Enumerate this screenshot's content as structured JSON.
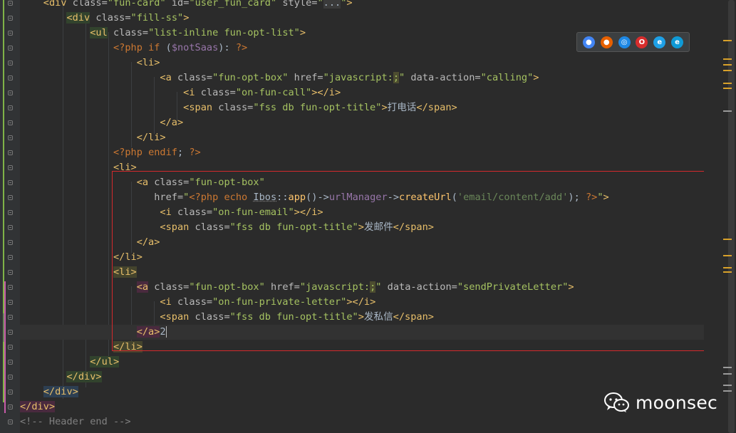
{
  "editor": {
    "lines": [
      [
        {
          "t": "    "
        },
        {
          "t": "<",
          "c": "tag"
        },
        {
          "t": "div ",
          "c": "tag"
        },
        {
          "t": "class=",
          "c": "attr"
        },
        {
          "t": "\"fun-card\"",
          "c": "val"
        },
        {
          "t": " id=",
          "c": "attr"
        },
        {
          "t": "\"user_fun_card\"",
          "c": "val"
        },
        {
          "t": " style=",
          "c": "attr"
        },
        {
          "t": "\"",
          "c": "val"
        },
        {
          "t": "...",
          "c": "fold"
        },
        {
          "t": "\"",
          "c": "val"
        },
        {
          "t": ">",
          "c": "tag"
        }
      ],
      [
        {
          "t": "        "
        },
        {
          "t": "<div",
          "c": "tag",
          "h": "green"
        },
        {
          "t": " class=",
          "c": "attr"
        },
        {
          "t": "\"fill-ss\"",
          "c": "val"
        },
        {
          "t": ">",
          "c": "tag"
        }
      ],
      [
        {
          "t": "            "
        },
        {
          "t": "<ul",
          "c": "tag",
          "h": "green"
        },
        {
          "t": " class=",
          "c": "attr"
        },
        {
          "t": "\"list-inline fun-opt-list\"",
          "c": "val"
        },
        {
          "t": ">",
          "c": "tag"
        }
      ],
      [
        {
          "t": "                "
        },
        {
          "t": "<?php ",
          "c": "php"
        },
        {
          "t": "if ",
          "c": "php"
        },
        {
          "t": "(",
          "c": "pl"
        },
        {
          "t": "$notSaas",
          "c": "var"
        },
        {
          "t": "): ",
          "c": "pl"
        },
        {
          "t": "?>",
          "c": "php"
        }
      ],
      [
        {
          "t": "                    "
        },
        {
          "t": "<li>",
          "c": "tag"
        }
      ],
      [
        {
          "t": "                        "
        },
        {
          "t": "<a",
          "c": "tag"
        },
        {
          "t": " class=",
          "c": "attr"
        },
        {
          "t": "\"fun-opt-box\"",
          "c": "val"
        },
        {
          "t": " href=",
          "c": "attr"
        },
        {
          "t": "\"javascript:",
          "c": "val"
        },
        {
          "t": ";",
          "c": "val",
          "h": "semi"
        },
        {
          "t": "\"",
          "c": "val"
        },
        {
          "t": " data-action=",
          "c": "attr"
        },
        {
          "t": "\"calling\"",
          "c": "val"
        },
        {
          "t": ">",
          "c": "tag"
        }
      ],
      [
        {
          "t": "                            "
        },
        {
          "t": "<i",
          "c": "tag"
        },
        {
          "t": " class=",
          "c": "attr"
        },
        {
          "t": "\"on-fun-call\"",
          "c": "val"
        },
        {
          "t": "></i>",
          "c": "tag"
        }
      ],
      [
        {
          "t": "                            "
        },
        {
          "t": "<span",
          "c": "tag"
        },
        {
          "t": " class=",
          "c": "attr"
        },
        {
          "t": "\"fss db fun-opt-title\"",
          "c": "val"
        },
        {
          "t": ">",
          "c": "tag"
        },
        {
          "t": "打电话",
          "c": "pl"
        },
        {
          "t": "</span>",
          "c": "tag"
        }
      ],
      [
        {
          "t": "                        "
        },
        {
          "t": "</a>",
          "c": "tag"
        }
      ],
      [
        {
          "t": "                    "
        },
        {
          "t": "</li>",
          "c": "tag"
        }
      ],
      [
        {
          "t": "                "
        },
        {
          "t": "<?php ",
          "c": "php"
        },
        {
          "t": "endif",
          "c": "php"
        },
        {
          "t": "; ",
          "c": "pl"
        },
        {
          "t": "?>",
          "c": "php"
        }
      ],
      [
        {
          "t": "                "
        },
        {
          "t": "<li>",
          "c": "tag"
        }
      ],
      [
        {
          "t": "                    "
        },
        {
          "t": "<a",
          "c": "tag"
        },
        {
          "t": " class=",
          "c": "attr"
        },
        {
          "t": "\"fun-opt-box\"",
          "c": "val"
        }
      ],
      [
        {
          "t": "                       "
        },
        {
          "t": "href=",
          "c": "attr"
        },
        {
          "t": "\"",
          "c": "val"
        },
        {
          "t": "<?php ",
          "c": "php"
        },
        {
          "t": "echo ",
          "c": "php"
        },
        {
          "t": "Ibos",
          "c": "cls"
        },
        {
          "t": "::",
          "c": "pl"
        },
        {
          "t": "app",
          "c": "fn"
        },
        {
          "t": "()->",
          "c": "pl"
        },
        {
          "t": "urlManager",
          "c": "var"
        },
        {
          "t": "->",
          "c": "pl"
        },
        {
          "t": "createUrl",
          "c": "fn"
        },
        {
          "t": "(",
          "c": "pl"
        },
        {
          "t": "'email/content/add'",
          "c": "sq"
        },
        {
          "t": "); ",
          "c": "pl"
        },
        {
          "t": "?>",
          "c": "php"
        },
        {
          "t": "\"",
          "c": "val"
        },
        {
          "t": ">",
          "c": "tag"
        }
      ],
      [
        {
          "t": "                        "
        },
        {
          "t": "<i",
          "c": "tag"
        },
        {
          "t": " class=",
          "c": "attr"
        },
        {
          "t": "\"on-fun-email\"",
          "c": "val"
        },
        {
          "t": "></i>",
          "c": "tag"
        }
      ],
      [
        {
          "t": "                        "
        },
        {
          "t": "<span",
          "c": "tag"
        },
        {
          "t": " class=",
          "c": "attr"
        },
        {
          "t": "\"fss db fun-opt-title\"",
          "c": "val"
        },
        {
          "t": ">",
          "c": "tag"
        },
        {
          "t": "发邮件",
          "c": "pl"
        },
        {
          "t": "</span>",
          "c": "tag"
        }
      ],
      [
        {
          "t": "                    "
        },
        {
          "t": "</a>",
          "c": "tag"
        }
      ],
      [
        {
          "t": "                "
        },
        {
          "t": "</li>",
          "c": "tag"
        }
      ],
      [
        {
          "t": "                "
        },
        {
          "t": "<li>",
          "c": "tag",
          "h": "yellow"
        }
      ],
      [
        {
          "t": "                    "
        },
        {
          "t": "<a",
          "c": "tag",
          "h": "pink"
        },
        {
          "t": " class=",
          "c": "attr"
        },
        {
          "t": "\"fun-opt-box\"",
          "c": "val"
        },
        {
          "t": " href=",
          "c": "attr"
        },
        {
          "t": "\"javascript:",
          "c": "val"
        },
        {
          "t": ";",
          "c": "val",
          "h": "semi"
        },
        {
          "t": "\"",
          "c": "val"
        },
        {
          "t": " data-action=",
          "c": "attr"
        },
        {
          "t": "\"sendPrivateLetter\"",
          "c": "val"
        },
        {
          "t": ">",
          "c": "tag"
        }
      ],
      [
        {
          "t": "                        "
        },
        {
          "t": "<i",
          "c": "tag"
        },
        {
          "t": " class=",
          "c": "attr"
        },
        {
          "t": "\"on-fun-private-letter\"",
          "c": "val"
        },
        {
          "t": "></i>",
          "c": "tag"
        }
      ],
      [
        {
          "t": "                        "
        },
        {
          "t": "<span",
          "c": "tag"
        },
        {
          "t": " class=",
          "c": "attr"
        },
        {
          "t": "\"fss db fun-opt-title\"",
          "c": "val"
        },
        {
          "t": ">",
          "c": "tag"
        },
        {
          "t": "发私信",
          "c": "pl"
        },
        {
          "t": "</span>",
          "c": "tag"
        }
      ],
      [
        {
          "t": "                    "
        },
        {
          "t": "</a>",
          "c": "tag",
          "h": "pink"
        },
        {
          "t": "2",
          "c": "pl",
          "caret": true
        }
      ],
      [
        {
          "t": "                "
        },
        {
          "t": "</li>",
          "c": "tag",
          "h": "yellow"
        }
      ],
      [
        {
          "t": "            "
        },
        {
          "t": "</ul>",
          "c": "tag",
          "h": "green"
        }
      ],
      [
        {
          "t": "        "
        },
        {
          "t": "</div>",
          "c": "tag",
          "h": "green"
        }
      ],
      [
        {
          "t": "    "
        },
        {
          "t": "</div>",
          "c": "tag",
          "h": "blue"
        }
      ],
      [
        {
          "t": "</div>",
          "c": "tag",
          "h": "pink"
        }
      ],
      [
        {
          "t": "<!-- Header end -->",
          "c": "cm"
        }
      ]
    ]
  },
  "browsers": [
    {
      "name": "chrome",
      "color": "#4285f4",
      "glyph": "●"
    },
    {
      "name": "firefox",
      "color": "#e66000",
      "glyph": "●"
    },
    {
      "name": "safari",
      "color": "#1e88e5",
      "glyph": "◎"
    },
    {
      "name": "opera",
      "color": "#d62d2d",
      "glyph": "O"
    },
    {
      "name": "ie",
      "color": "#1ea0e6",
      "glyph": "e"
    },
    {
      "name": "edge",
      "color": "#0f9ad6",
      "glyph": "e"
    }
  ],
  "watermark": {
    "text": "moonsec"
  },
  "colors": {
    "background": "#2b2b2b",
    "selection_border": "#d3292c",
    "tag": "#e8bf6a",
    "attribute": "#bababa",
    "string": "#a5c261",
    "keyword": "#cc7832"
  }
}
